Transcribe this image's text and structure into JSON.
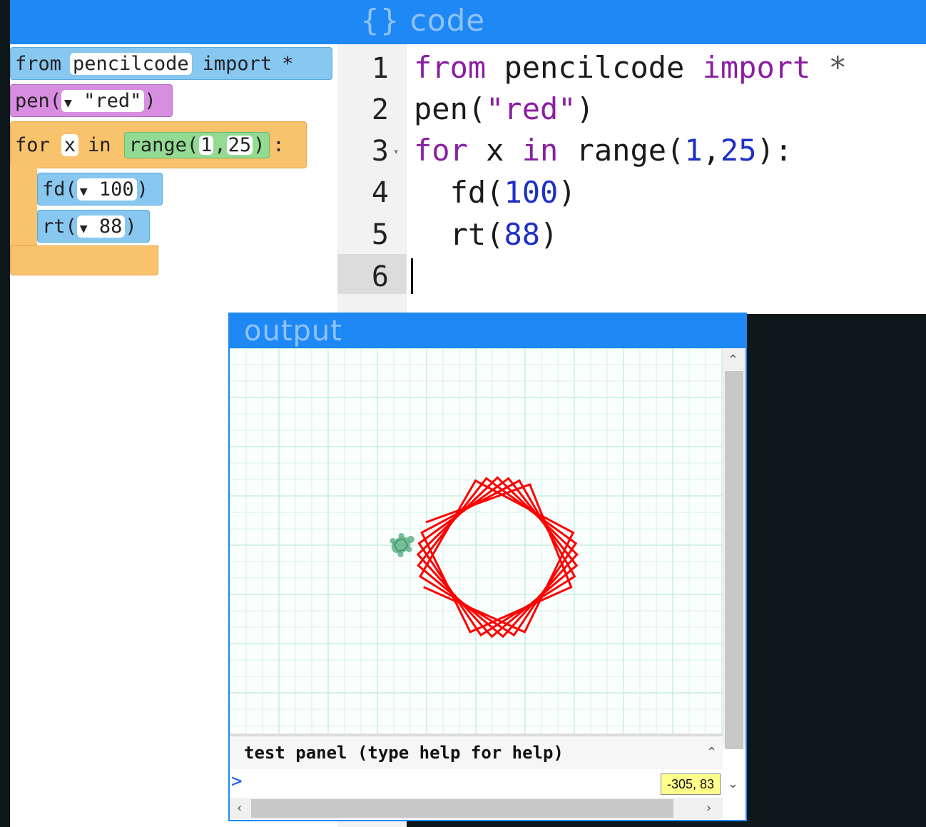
{
  "code_panel": {
    "title": "{} code"
  },
  "blocks": {
    "import_block": {
      "from": "from",
      "module": "pencilcode",
      "import": "import",
      "star": "*"
    },
    "pen_block": {
      "func": "pen(",
      "dropdown": "▼",
      "value": "\"red\"",
      "close": ")"
    },
    "for_block": {
      "for": "for",
      "var": "x",
      "in": "in",
      "range_func": "range(",
      "start": "1",
      "comma": ",",
      "stop": "25",
      "range_close": ")",
      "colon": ":"
    },
    "fd_block": {
      "func": "fd(",
      "dropdown": "▼",
      "value": "100",
      "close": ")"
    },
    "rt_block": {
      "func": "rt(",
      "dropdown": "▼",
      "value": "88",
      "close": ")"
    }
  },
  "editor": {
    "line_numbers": [
      "1",
      "2",
      "3",
      "4",
      "5",
      "6"
    ],
    "lines": {
      "l1": {
        "kw1": "from",
        "mod": " pencilcode ",
        "kw2": "import",
        "star": " *"
      },
      "l2": {
        "a": "pen(",
        "str": "\"red\"",
        "b": ")"
      },
      "l3": {
        "kw1": "for",
        "a": " x ",
        "kw2": "in",
        "b": " range(",
        "n1": "1",
        "c": ",",
        "n2": "25",
        "d": "):"
      },
      "l4": {
        "a": "  fd(",
        "n": "100",
        "b": ")"
      },
      "l5": {
        "a": "  rt(",
        "n": "88",
        "b": ")"
      }
    },
    "fold_marker": "▾"
  },
  "output_panel": {
    "title": "output",
    "test_panel_text": "test panel (type help for help)",
    "prompt": ">",
    "coordinates": "-305, 83"
  },
  "drawing": {
    "pen_color": "#ff0000",
    "iterations": 24,
    "step": 100,
    "turn_degrees": 88,
    "turtle_color": "#5fb38a"
  },
  "colors": {
    "header_blue": "#1e88f5",
    "title_text": "#8fc3fb",
    "grid_line": "#c8ede0"
  },
  "scroll_arrows": {
    "up": "⌃",
    "down": "⌄",
    "left": "‹",
    "right": "›"
  }
}
